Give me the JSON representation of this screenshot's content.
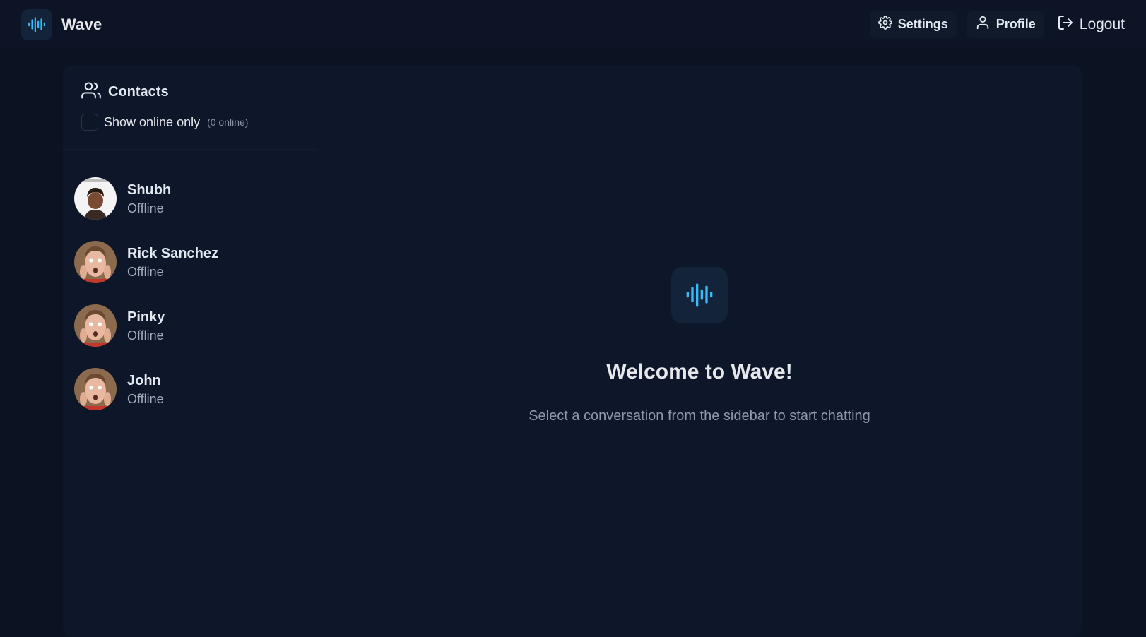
{
  "app": {
    "name": "Wave",
    "accent_color": "#38bdf8",
    "logo_icon": "wave-icon"
  },
  "navbar": {
    "settings_label": "Settings",
    "profile_label": "Profile",
    "logout_label": "Logout"
  },
  "sidebar": {
    "title": "Contacts",
    "filter_label": "Show online only",
    "online_count": "(0 online)",
    "filter_checked": false,
    "contacts": [
      {
        "name": "Shubh",
        "status": "Offline"
      },
      {
        "name": "Rick Sanchez",
        "status": "Offline"
      },
      {
        "name": "Pinky",
        "status": "Offline"
      },
      {
        "name": "John",
        "status": "Offline"
      }
    ]
  },
  "main": {
    "welcome_title": "Welcome to Wave!",
    "welcome_subtitle": "Select a conversation from the sidebar to start chatting"
  }
}
